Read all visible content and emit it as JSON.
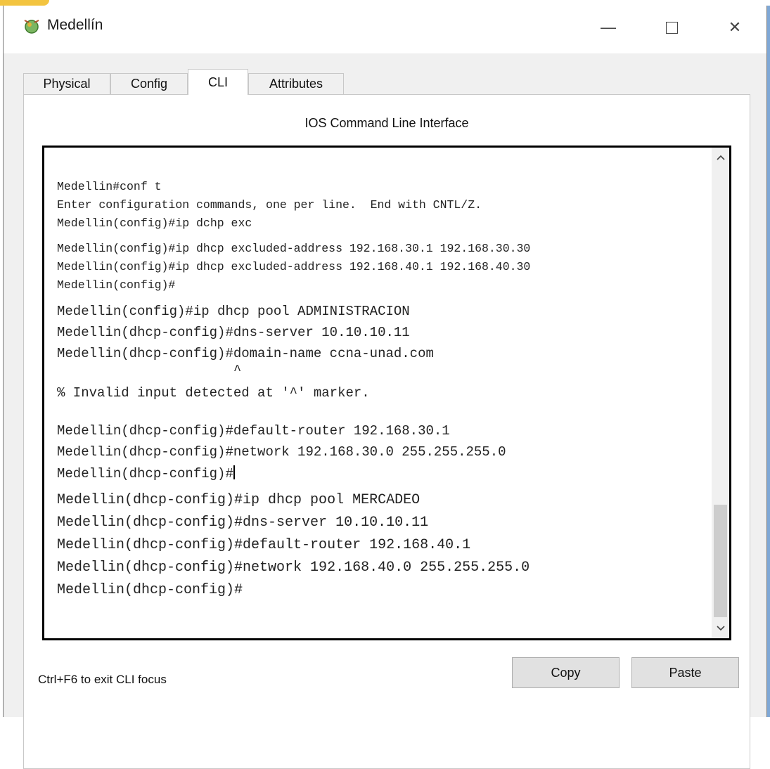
{
  "window": {
    "title": "Medellín",
    "minimize_glyph": "—",
    "close_glyph": "✕",
    "icon": "router-icon"
  },
  "tabs": [
    {
      "label": "Physical",
      "active": false
    },
    {
      "label": "Config",
      "active": false
    },
    {
      "label": "CLI",
      "active": true
    },
    {
      "label": "Attributes",
      "active": false
    }
  ],
  "panel": {
    "title": "IOS Command Line Interface"
  },
  "cli": {
    "lines": [
      "Medellin#conf t",
      "Enter configuration commands, one per line.  End with CNTL/Z.",
      "Medellin(config)#ip dchp exc",
      "Medellin(config)#ip dhcp excluded-address 192.168.30.1 192.168.30.30",
      "Medellin(config)#ip dhcp excluded-address 192.168.40.1 192.168.40.30",
      "Medellin(config)#",
      "Medellin(config)#ip dhcp pool ADMINISTRACION",
      "Medellin(dhcp-config)#dns-server 10.10.10.11",
      "Medellin(dhcp-config)#domain-name ccna-unad.com",
      "                      ^",
      "% Invalid input detected at '^' marker.",
      "",
      "Medellin(dhcp-config)#default-router 192.168.30.1",
      "Medellin(dhcp-config)#network 192.168.30.0 255.255.255.0",
      "Medellin(dhcp-config)#",
      "Medellin(dhcp-config)#ip dhcp pool MERCADEO",
      "Medellin(dhcp-config)#dns-server 10.10.10.11",
      "Medellin(dhcp-config)#default-router 192.168.40.1",
      "Medellin(dhcp-config)#network 192.168.40.0 255.255.255.0",
      "Medellin(dhcp-config)#"
    ]
  },
  "footer": {
    "hint": "Ctrl+F6 to exit CLI focus",
    "copy_label": "Copy",
    "paste_label": "Paste"
  },
  "colors": {
    "accent": "#f3c440",
    "right_strip": "#7fa8d6",
    "client_bg": "#f0f0f0"
  }
}
